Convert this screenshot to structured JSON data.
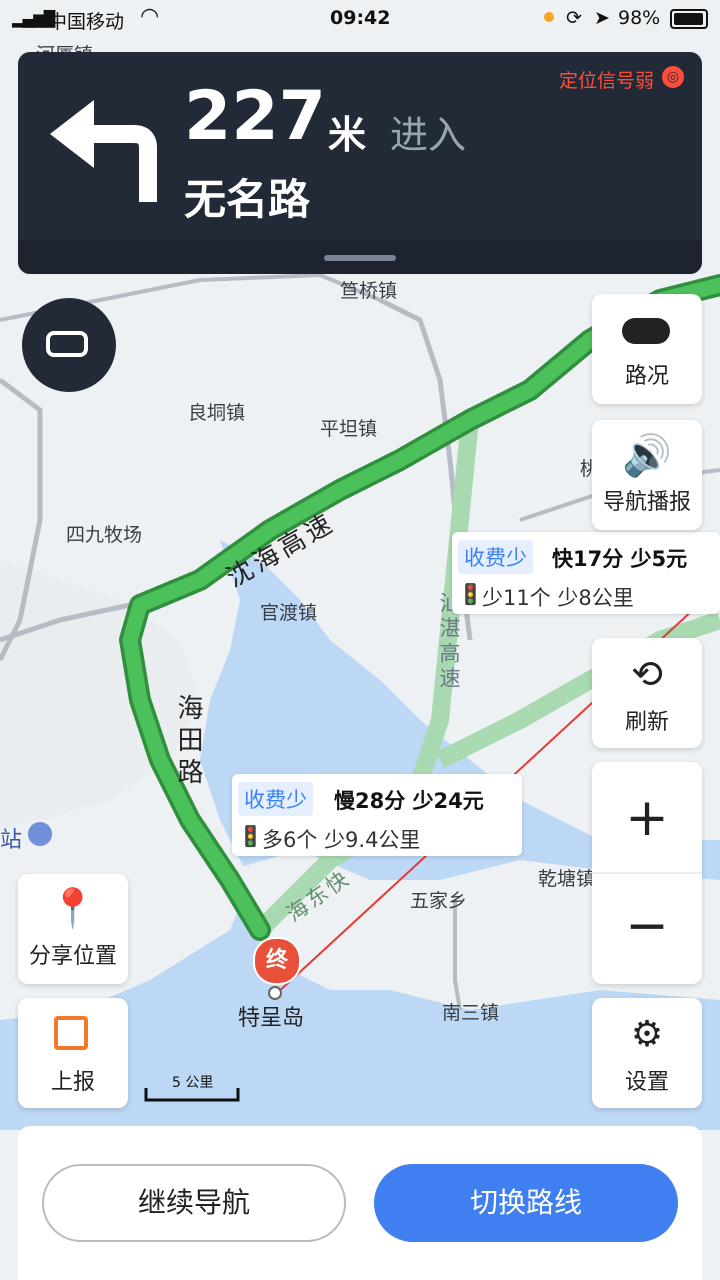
{
  "status_bar": {
    "carrier": "中国移动",
    "time": "09:42",
    "battery": "98%"
  },
  "nav": {
    "distance": "227",
    "unit": "米",
    "action": "进入",
    "road": "无名路",
    "signal_warning": "定位信号弱"
  },
  "map_labels": {
    "town1": "河厦镇",
    "town2": "笪桥镇",
    "town3": "良垌镇",
    "town4": "平坦镇",
    "town5": "四九牧场",
    "town6": "官渡镇",
    "town7": "五家乡",
    "town8": "乾塘镇",
    "town9": "南三镇",
    "island": "特呈岛",
    "station": "站",
    "road_shenhai": "沈海高速",
    "road_haitian": "海田路",
    "road_zhanzhan": "汕湛高速",
    "road_haidongkuai": "海东快",
    "scale": "5 公里",
    "partial_right": "桃"
  },
  "right_buttons": {
    "traffic": "路况",
    "broadcast": "导航播报",
    "refresh": "刷新",
    "zoom_in": "+",
    "zoom_out": "−",
    "settings": "设置"
  },
  "left_buttons": {
    "share": "分享位置",
    "report": "上报"
  },
  "route_tips": [
    {
      "tag": "收费少",
      "main": "快17分 少5元",
      "sub": "少11个 少8公里"
    },
    {
      "tag": "收费少",
      "main": "慢28分 少24元",
      "sub": "多6个 少9.4公里"
    }
  ],
  "end_marker": "终",
  "bottom": {
    "continue": "继续导航",
    "switch": "切换路线"
  },
  "colors": {
    "route": "#37b24d",
    "panel": "#222a37",
    "accent": "#3f7ff0",
    "warning": "#ff4d3a"
  }
}
